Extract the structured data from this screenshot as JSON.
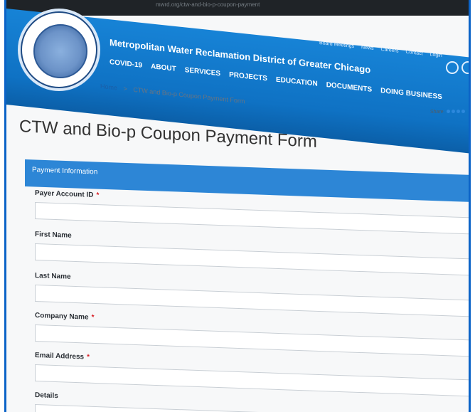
{
  "browser": {
    "url": "mwrd.org/ctw-and-bio-p-coupon-payment"
  },
  "header": {
    "site_name": "Metropolitan Water Reclamation District of Greater Chicago",
    "nav": [
      "COVID-19",
      "ABOUT",
      "SERVICES",
      "PROJECTS",
      "EDUCATION",
      "DOCUMENTS",
      "DOING BUSINESS"
    ],
    "top_links": [
      "Board Meetings",
      "News",
      "Careers",
      "Contact",
      "Login"
    ]
  },
  "breadcrumb": {
    "home": "Home",
    "sep": ">",
    "current": "CTW and Bio-p Coupon Payment Form"
  },
  "share_label": "Share",
  "page_title": "CTW and Bio-p Coupon Payment Form",
  "panel_title": "Payment Information",
  "fields": [
    {
      "label": "Payer Account ID",
      "required": true
    },
    {
      "label": "First Name",
      "required": false
    },
    {
      "label": "Last Name",
      "required": false
    },
    {
      "label": "Company Name",
      "required": true
    },
    {
      "label": "Email Address",
      "required": true
    },
    {
      "label": "Details",
      "required": false
    }
  ]
}
